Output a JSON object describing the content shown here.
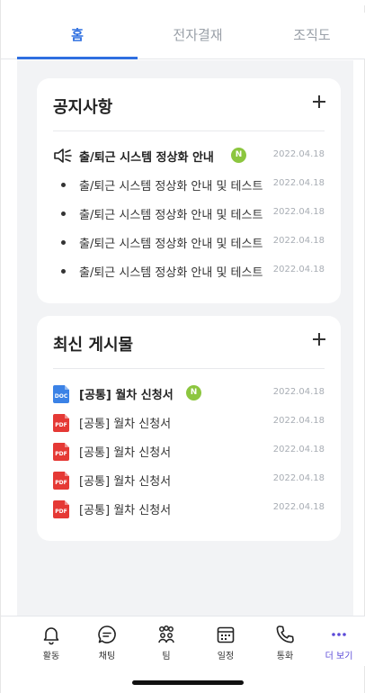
{
  "tabs": [
    {
      "label": "홈",
      "active": true
    },
    {
      "label": "전자결재",
      "active": false
    },
    {
      "label": "조직도",
      "active": false
    }
  ],
  "notice": {
    "title": "공지사항",
    "items": [
      {
        "title": "출/퇴근 시스템 정상화 안내",
        "date": "2022.04.18",
        "badge": "N",
        "important": true,
        "icon": "speaker-icon"
      },
      {
        "title": "출/퇴근 시스템 정상화 안내 및 테스트",
        "date": "2022.04.18"
      },
      {
        "title": "출/퇴근 시스템 정상화 안내 및 테스트",
        "date": "2022.04.18"
      },
      {
        "title": "출/퇴근 시스템 정상화 안내 및 테스트",
        "date": "2022.04.18"
      },
      {
        "title": "출/퇴근 시스템 정상화 안내 및 테스트",
        "date": "2022.04.18"
      }
    ]
  },
  "posts": {
    "title": "최신 게시물",
    "items": [
      {
        "title": "[공통] 월차 신청서",
        "date": "2022.04.18",
        "badge": "N",
        "file_type": "DOC",
        "bold": true
      },
      {
        "title": "[공통] 월차 신청서",
        "date": "2022.04.18",
        "file_type": "PDF"
      },
      {
        "title": "[공통] 월차 신청서",
        "date": "2022.04.18",
        "file_type": "PDF"
      },
      {
        "title": "[공통] 월차 신청서",
        "date": "2022.04.18",
        "file_type": "PDF"
      },
      {
        "title": "[공통] 월차 신청서",
        "date": "2022.04.18",
        "file_type": "PDF"
      }
    ]
  },
  "bottom_nav": [
    {
      "label": "활동",
      "icon": "bell-icon"
    },
    {
      "label": "채팅",
      "icon": "chat-icon"
    },
    {
      "label": "팀",
      "icon": "team-icon"
    },
    {
      "label": "일정",
      "icon": "calendar-icon"
    },
    {
      "label": "통화",
      "icon": "phone-icon"
    },
    {
      "label": "더 보기",
      "icon": "more-icon",
      "active": true
    }
  ],
  "colors": {
    "accent": "#2f6fe0",
    "badge": "#8cc63f",
    "more_active": "#5b4ad8",
    "doc": "#3b82e6",
    "pdf": "#e53935"
  }
}
